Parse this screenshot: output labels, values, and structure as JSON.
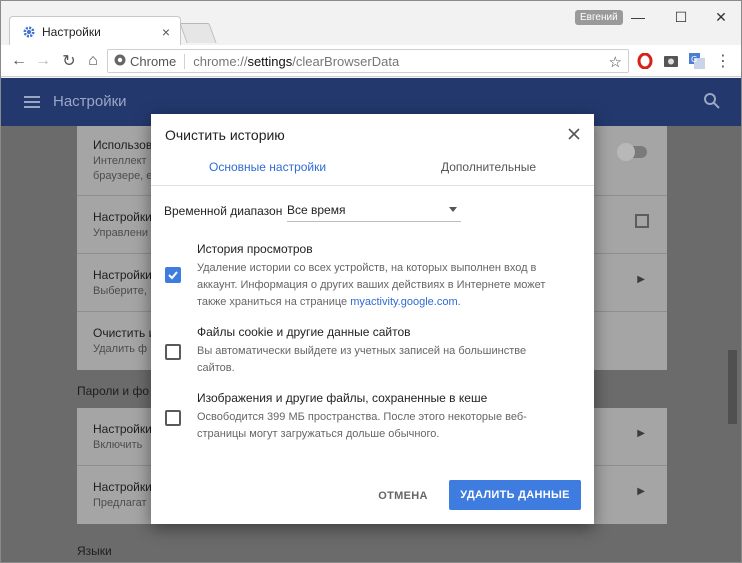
{
  "window": {
    "username": "Евгений",
    "tab": {
      "title": "Настройки"
    },
    "controls": {
      "minimize": "—",
      "maximize": "☐",
      "close": "✕"
    }
  },
  "toolbar": {
    "secure_label": "Chrome",
    "url_scheme": "chrome://",
    "url_host": "settings",
    "url_path": "/clearBrowserData"
  },
  "settings": {
    "header_title": "Настройки",
    "card1": [
      {
        "title": "Использов",
        "sub": "Интеллект"
      },
      {
        "title": "Настройки",
        "sub": "Управлени"
      },
      {
        "title": "Настройки",
        "sub": "Выберите,"
      },
      {
        "title": "Очистить и",
        "sub": "Удалить ф"
      }
    ],
    "card1_sub_extra": "браузере, е",
    "section_passwords": "Пароли и фо",
    "card2": [
      {
        "title": "Настройки",
        "sub": "Включить"
      },
      {
        "title": "Настройки",
        "sub": "Предлагат"
      }
    ],
    "section_languages": "Языки"
  },
  "dialog": {
    "title": "Очистить историю",
    "tabs": {
      "basic": "Основные настройки",
      "advanced": "Дополнительные"
    },
    "range_label": "Временной диапазон",
    "range_value": "Все время",
    "options": [
      {
        "title": "История просмотров",
        "desc_before": "Удаление истории со всех устройств, на которых выполнен вход в аккаунт. Информация о других ваших действиях в Интернете может также храниться на странице ",
        "desc_link": "myactivity.google.com",
        "desc_after": ".",
        "checked": true
      },
      {
        "title": "Файлы cookie и другие данные сайтов",
        "desc": "Вы автоматически выйдете из учетных записей на большинстве сайтов.",
        "checked": false
      },
      {
        "title": "Изображения и другие файлы, сохраненные в кеше",
        "desc": "Освободится 399 МБ пространства. После этого некоторые веб-страницы могут загружаться дольше обычного.",
        "checked": false
      }
    ],
    "cancel_label": "ОТМЕНА",
    "delete_label": "УДАЛИТЬ ДАННЫЕ"
  },
  "colors": {
    "accent": "#3f7ce0",
    "header": "#23396e",
    "overlay_bg": "#6b6b6b"
  }
}
